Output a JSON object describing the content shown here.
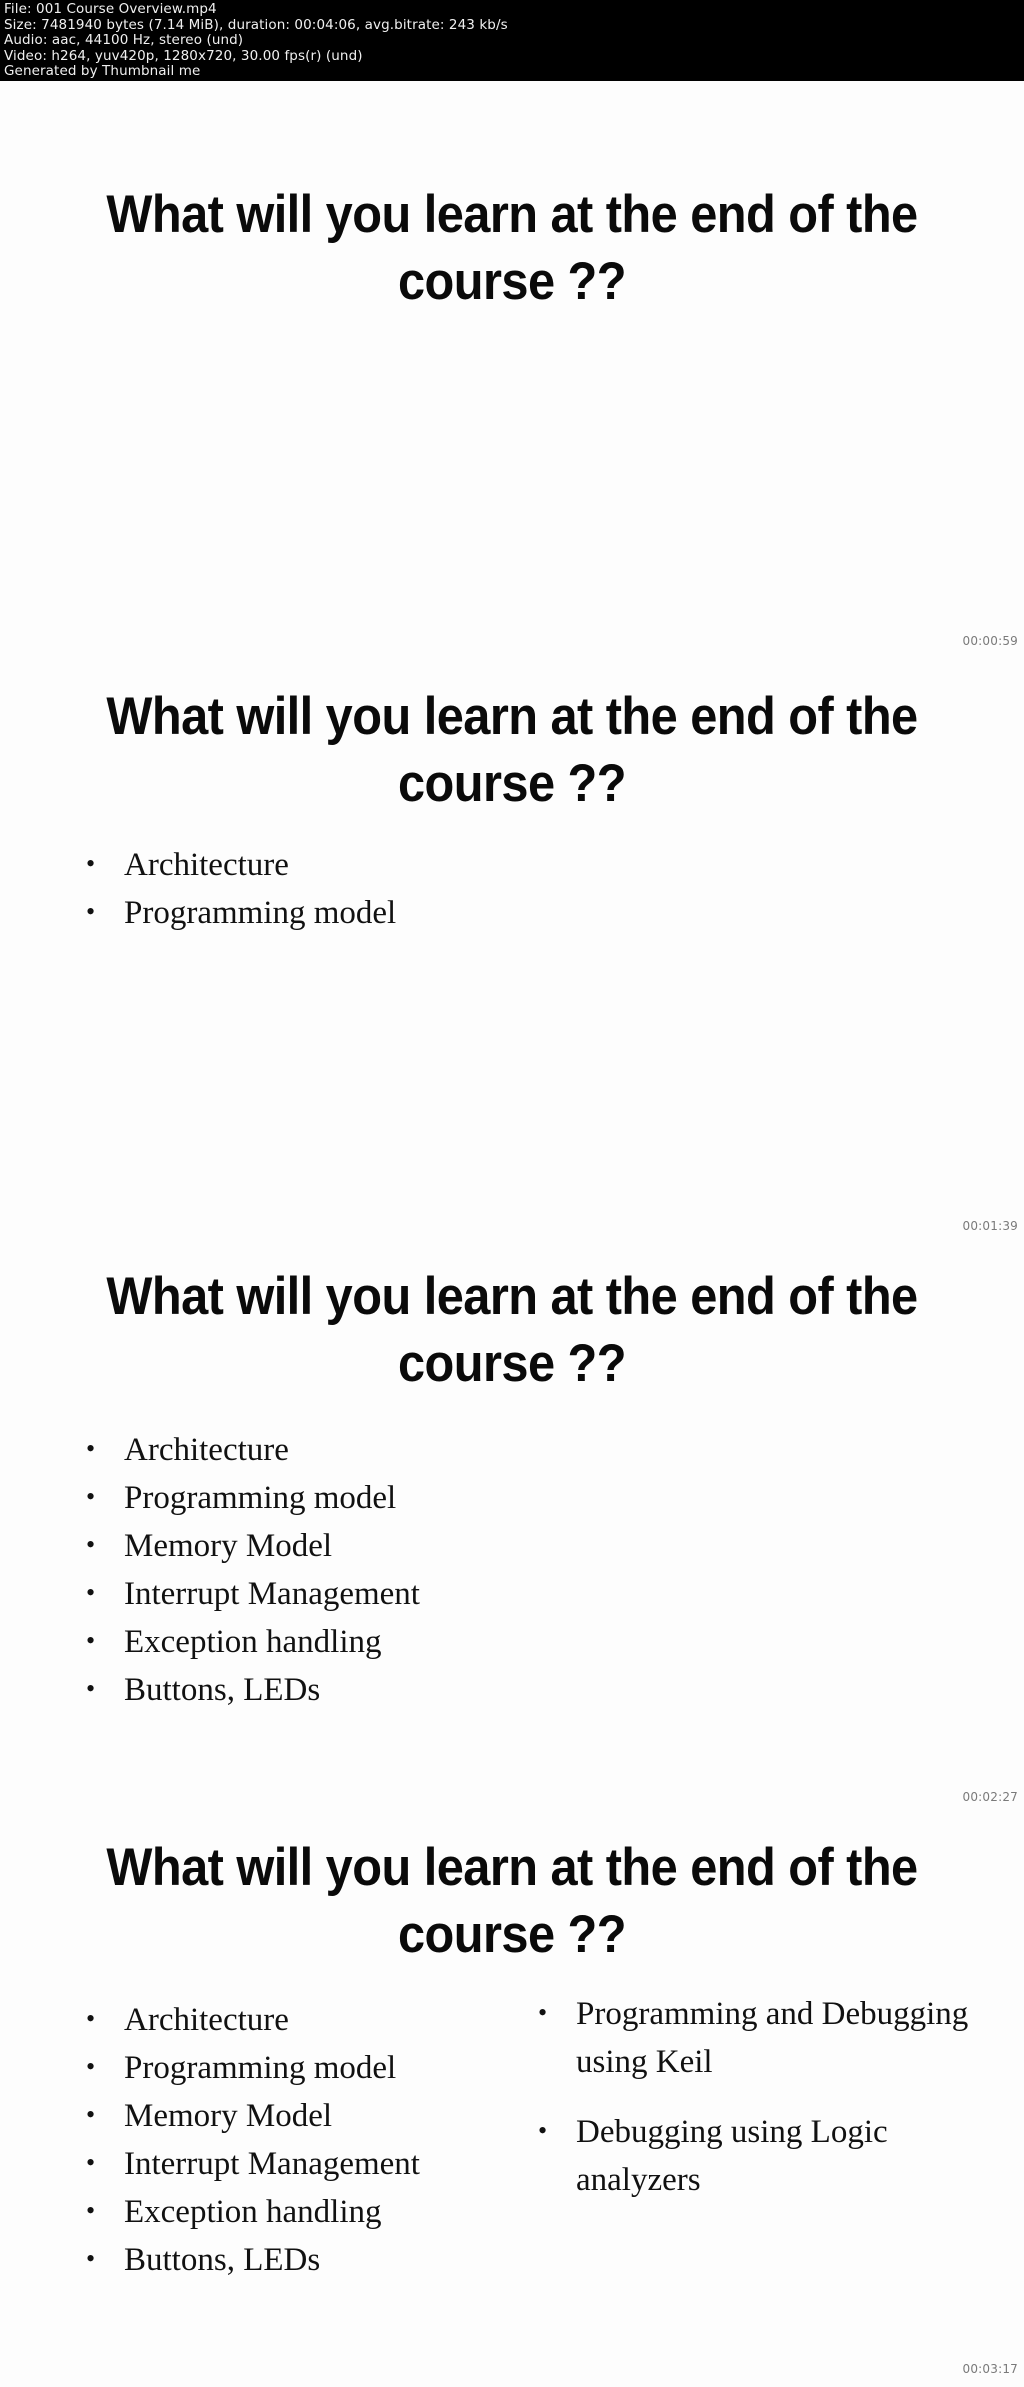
{
  "meta": {
    "file_line": "File: 001 Course Overview.mp4",
    "size_line": "Size: 7481940 bytes (7.14 MiB), duration: 00:04:06, avg.bitrate: 243 kb/s",
    "audio_line": "Audio: aac, 44100 Hz, stereo (und)",
    "video_line": "Video: h264, yuv420p, 1280x720, 30.00 fps(r) (und)",
    "generator_line": "Generated by Thumbnail me"
  },
  "slide_title": "What will you learn at the end of the course ??",
  "thumbnails": [
    {
      "timestamp": "00:00:59",
      "title": "What will you learn at the end of the course ??",
      "left_bullets": [],
      "right_bullets": []
    },
    {
      "timestamp": "00:01:39",
      "title": "What will you learn at the end of the course ??",
      "left_bullets": [
        "Architecture",
        "Programming model"
      ],
      "right_bullets": []
    },
    {
      "timestamp": "00:02:27",
      "title": "What will you learn at the end of the course ??",
      "left_bullets": [
        "Architecture",
        "Programming model",
        "Memory Model",
        "Interrupt Management",
        "Exception handling",
        "Buttons, LEDs"
      ],
      "right_bullets": []
    },
    {
      "timestamp": "00:03:17",
      "title": "What will you learn at the end of the course ??",
      "left_bullets": [
        "Architecture",
        "Programming model",
        "Memory Model",
        "Interrupt Management",
        "Exception handling",
        "Buttons, LEDs"
      ],
      "right_bullets": [
        "Programming and Debugging using Keil",
        "Debugging using Logic analyzers"
      ]
    }
  ],
  "colors": {
    "header_background": "#000000",
    "header_text": "#f0f0f0",
    "slide_background": "#fdfdfd",
    "slide_text": "#111111",
    "title_text": "#0a0a0a",
    "timestamp_text": "#7a7a7a"
  }
}
